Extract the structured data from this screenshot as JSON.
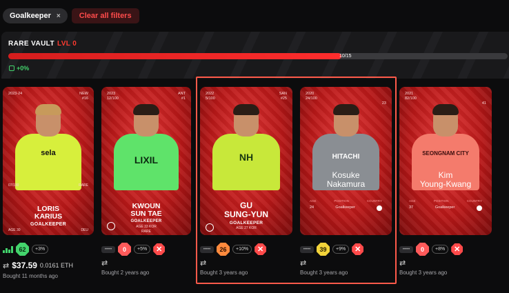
{
  "filters": {
    "chip_label": "Goalkeeper",
    "chip_close": "×",
    "clear_label": "Clear all filters"
  },
  "vault": {
    "title": "RARE VAULT",
    "level": "LVL 0",
    "count": "10/15",
    "progress": 0.667,
    "gain": "+0%"
  },
  "cards": [
    {
      "season": "2023-24",
      "serial": "07/100",
      "tag_top": "NEW",
      "tag_num": "#16",
      "first": "LORIS",
      "last": "KARIUS",
      "position": "GOALKEEPER",
      "age": "AGE 30",
      "country": "DEU",
      "rarity": "RARE",
      "sponsor": "sela",
      "row": {
        "score": "62",
        "pct": "+3%",
        "price": "$37.59",
        "eth": "0.0161 ETH",
        "bought": "Bought 11 months ago"
      }
    },
    {
      "season": "2023",
      "serial": "12/100",
      "tag_top": "ANT",
      "tag_num": "#1",
      "first": "KWOUN",
      "last": "SUN TAE",
      "position": "GOALKEEPER",
      "age": "AGE 33",
      "country": "KOR",
      "rarity": "RARE",
      "sponsor": "LIXIL",
      "row": {
        "score": "0",
        "pct": "+5%",
        "bought": "Bought 2 years ago"
      }
    },
    {
      "season": "2022",
      "serial": "5/100",
      "tag_top": "SAN",
      "tag_num": "#25",
      "first": "GU",
      "last": "SUNG-YUN",
      "position": "GOALKEEPER",
      "age": "AGE 27",
      "country": "KOR",
      "sponsor": "NH",
      "row": {
        "score": "26",
        "pct": "+10%",
        "bought": "Bought 3 years ago"
      }
    },
    {
      "season": "2020",
      "serial": "24/100",
      "tag_num": "23",
      "first": "Kosuke",
      "last": "Nakamura",
      "position": "Goalkeeper",
      "age_value": "24",
      "stat_labels": [
        "AGE",
        "POSITION",
        "COUNTRY"
      ],
      "sponsor": "HITACHI",
      "row": {
        "score": "39",
        "pct": "+9%",
        "bought": "Bought 3 years ago"
      }
    },
    {
      "season": "2021",
      "serial": "82/100",
      "tag_num": "41",
      "first": "Kim",
      "last": "Young-Kwang",
      "position": "Goalkeeper",
      "age_value": "37",
      "stat_labels": [
        "AGE",
        "POSITION",
        "COUNTRY"
      ],
      "sponsor": "SEONGNAM CITY",
      "row": {
        "score": "0",
        "pct": "+8%",
        "bought": "Bought 3 years ago"
      }
    }
  ],
  "colors": {
    "accent": "#ff3b30",
    "card_red": "#c41e1e",
    "gain_green": "#43d46c"
  }
}
